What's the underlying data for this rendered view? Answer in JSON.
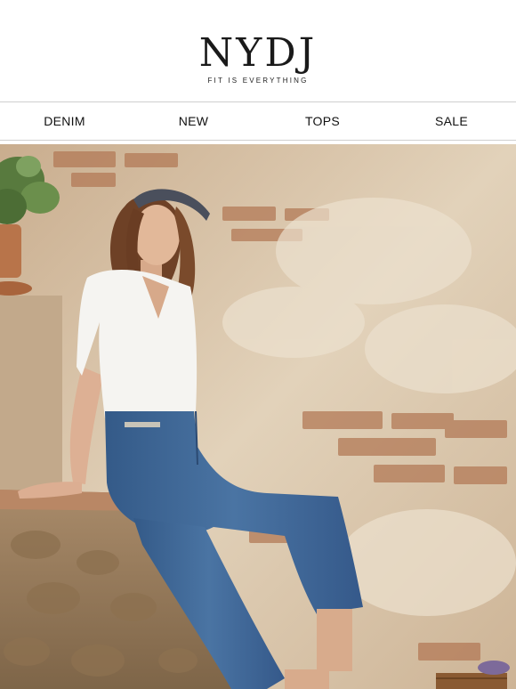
{
  "brand": {
    "logo_text": "NYDJ",
    "tagline": "FIT IS EVERYTHING"
  },
  "nav": {
    "items": [
      {
        "label": "DENIM"
      },
      {
        "label": "NEW"
      },
      {
        "label": "TOPS"
      },
      {
        "label": "SALE"
      }
    ]
  },
  "hero": {
    "image_subject": "woman in white v-neck top and straight-leg blue jeans seated on a stone wall"
  },
  "colors": {
    "wall": "#dcc8ac",
    "brick": "#b0734f",
    "denim": "#3f6696",
    "top": "#f5f4f1",
    "foliage": "#587a3e",
    "pot": "#b8744a"
  }
}
